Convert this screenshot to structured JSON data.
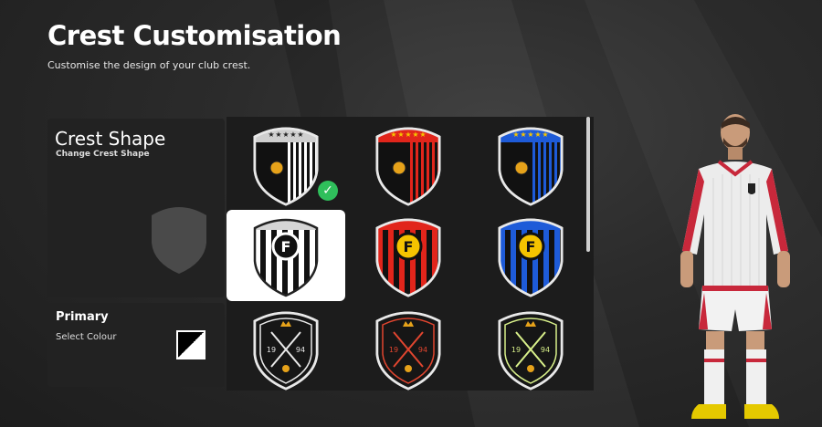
{
  "header": {
    "title": "Crest Customisation",
    "subtitle": "Customise the design of your club crest."
  },
  "crest_shape": {
    "title": "Crest Shape",
    "subtitle": "Change Crest Shape"
  },
  "primary": {
    "title": "Primary",
    "subtitle": "Select Colour",
    "swatch_colors": [
      "#000000",
      "#ffffff"
    ]
  },
  "crests": [
    {
      "name": "crest-stripes-white-black",
      "style": "stars-stripes",
      "accent": "#ffffff",
      "top": "#cfcfcf",
      "selected": false,
      "applied": true
    },
    {
      "name": "crest-stripes-red-black",
      "style": "stars-stripes",
      "accent": "#e1251b",
      "top": "#e1251b",
      "selected": false,
      "applied": false
    },
    {
      "name": "crest-stripes-blue-black",
      "style": "stars-stripes",
      "accent": "#1e5bd8",
      "top": "#1e5bd8",
      "selected": false,
      "applied": false
    },
    {
      "name": "crest-letter-f-white",
      "style": "letter-f",
      "accent": "#ffffff",
      "top": "#d5d5d5",
      "selected": true,
      "applied": false
    },
    {
      "name": "crest-letter-f-red",
      "style": "letter-f",
      "accent": "#e1251b",
      "top": "#e1251b",
      "selected": false,
      "applied": false
    },
    {
      "name": "crest-letter-f-blue",
      "style": "letter-f",
      "accent": "#1e5bd8",
      "top": "#1e5bd8",
      "selected": false,
      "applied": false
    },
    {
      "name": "crest-swords-white",
      "style": "swords",
      "accent": "#e8e8e8",
      "top": "#e8e8e8",
      "selected": false,
      "applied": false
    },
    {
      "name": "crest-swords-red",
      "style": "swords",
      "accent": "#e0452f",
      "top": "#e0452f",
      "selected": false,
      "applied": false
    },
    {
      "name": "crest-swords-lime",
      "style": "swords",
      "accent": "#d8f08a",
      "top": "#d8f08a",
      "selected": false,
      "applied": false
    }
  ],
  "crest_texts": {
    "letter": "F",
    "year_left": "19",
    "year_right": "94"
  },
  "colors": {
    "panel": "#222222",
    "grid": "#1c1c1c",
    "check": "#2fbf5b"
  }
}
